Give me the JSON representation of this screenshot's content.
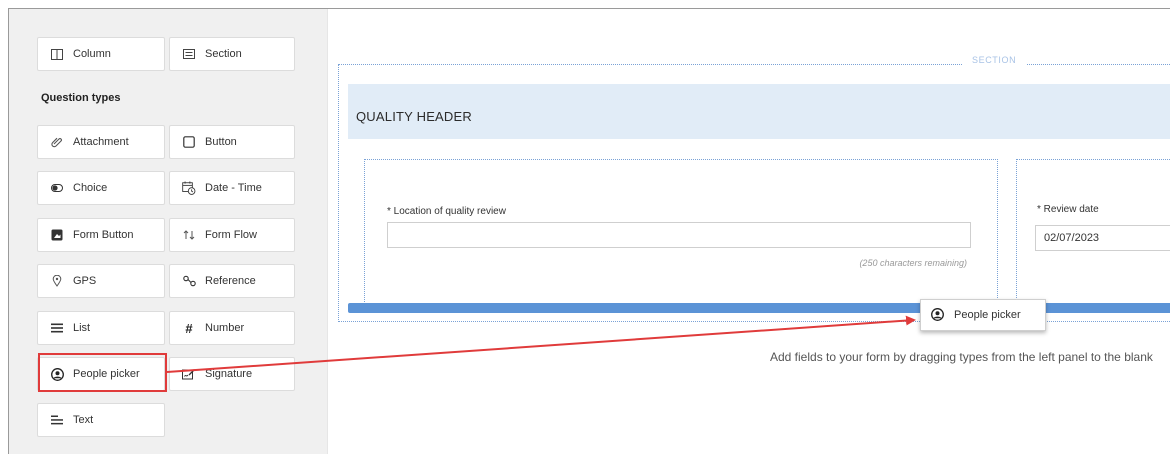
{
  "layout_tiles": [
    {
      "label": "Column",
      "icon": "columns-icon"
    },
    {
      "label": "Section",
      "icon": "section-icon"
    }
  ],
  "question_types_title": "Question types",
  "question_types": [
    {
      "label": "Attachment",
      "icon": "paperclip-icon"
    },
    {
      "label": "Button",
      "icon": "button-icon"
    },
    {
      "label": "Choice",
      "icon": "toggle-icon"
    },
    {
      "label": "Date - Time",
      "icon": "calendar-clock-icon"
    },
    {
      "label": "Form Button",
      "icon": "form-button-icon"
    },
    {
      "label": "Form Flow",
      "icon": "form-flow-icon"
    },
    {
      "label": "GPS",
      "icon": "location-pin-icon"
    },
    {
      "label": "Reference",
      "icon": "reference-icon"
    },
    {
      "label": "List",
      "icon": "list-icon"
    },
    {
      "label": "Number",
      "icon": "hash-icon"
    },
    {
      "label": "People picker",
      "icon": "person-icon"
    },
    {
      "label": "Signature",
      "icon": "signature-icon"
    },
    {
      "label": "Text",
      "icon": "text-icon"
    }
  ],
  "canvas": {
    "section_label": "SECTION",
    "header_title": "QUALITY HEADER",
    "field1": {
      "label": "* Location of quality review",
      "value": "",
      "hint": "(250 characters remaining)"
    },
    "field2": {
      "label": "* Review date",
      "value": "02/07/2023"
    },
    "drag_chip_label": "People picker",
    "drop_hint": "Add fields to your form by dragging types from the left panel to the blank"
  },
  "colors": {
    "highlight": "#e03b3b",
    "header_bg": "#e1ecf7",
    "accent_blue": "#5b93d6"
  }
}
